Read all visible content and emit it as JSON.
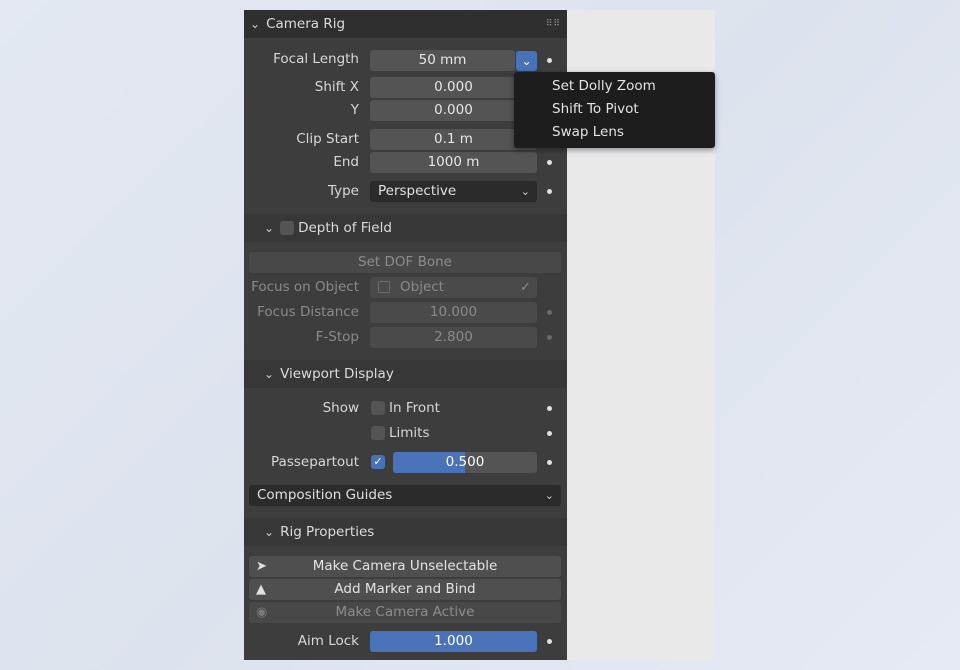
{
  "panel": {
    "title": "Camera Rig",
    "focal_length": {
      "label": "Focal Length",
      "value": "50 mm"
    },
    "shift_x": {
      "label": "Shift X",
      "value": "0.000"
    },
    "shift_y": {
      "label": "Y",
      "value": "0.000"
    },
    "clip_start": {
      "label": "Clip Start",
      "value": "0.1 m"
    },
    "clip_end": {
      "label": "End",
      "value": "1000 m"
    },
    "type": {
      "label": "Type",
      "value": "Perspective"
    }
  },
  "dof": {
    "title": "Depth of Field",
    "enabled": false,
    "set_bone_label": "Set DOF Bone",
    "focus_object": {
      "label": "Focus on Object",
      "placeholder": "Object"
    },
    "focus_distance": {
      "label": "Focus Distance",
      "value": "10.000"
    },
    "fstop": {
      "label": "F-Stop",
      "value": "2.800"
    }
  },
  "viewport_display": {
    "title": "Viewport Display",
    "show_label": "Show",
    "in_front": {
      "label": "In Front",
      "checked": false
    },
    "limits": {
      "label": "Limits",
      "checked": false
    },
    "passepartout": {
      "label": "Passepartout",
      "checked": true,
      "value": "0.500",
      "fraction": 0.5
    },
    "composition_guides": "Composition Guides"
  },
  "rig": {
    "title": "Rig Properties",
    "make_unselectable": "Make Camera Unselectable",
    "add_marker": "Add Marker and Bind",
    "make_active": "Make Camera Active",
    "aim_lock": {
      "label": "Aim Lock",
      "value": "1.000",
      "fraction": 1.0
    }
  },
  "context_menu": {
    "items": [
      "Set Dolly Zoom",
      "Shift To Pivot",
      "Swap Lens"
    ]
  },
  "colors": {
    "accent": "#4a72b8",
    "panel_bg": "#3d3d3d",
    "menu_bg": "#1d1d1d"
  }
}
